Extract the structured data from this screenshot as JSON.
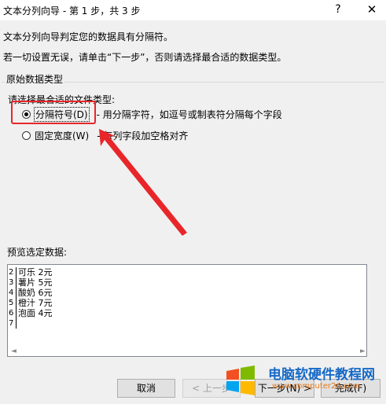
{
  "window": {
    "title": "文本分列向导 - 第 1 步，共 3 步",
    "help_label": "?",
    "close_label": "✕"
  },
  "intro": {
    "line1": "文本分列向导判定您的数据具有分隔符。",
    "line2": "若一切设置无误，请单击“下一步”，否则请选择最合适的数据类型。"
  },
  "group": {
    "title": "原始数据类型",
    "prompt": "请选择最合适的文件类型:",
    "options": [
      {
        "label": "分隔符号(D)",
        "description": "- 用分隔字符，如逗号或制表符分隔每个字段",
        "checked": true
      },
      {
        "label": "固定宽度(W)",
        "description": "- 每列字段加空格对齐",
        "checked": false
      }
    ]
  },
  "preview": {
    "label": "预览选定数据:",
    "rows": [
      {
        "num": "2",
        "text": "可乐 2元"
      },
      {
        "num": "3",
        "text": "薯片 5元"
      },
      {
        "num": "4",
        "text": "酸奶 6元"
      },
      {
        "num": "5",
        "text": "橙汁 7元"
      },
      {
        "num": "6",
        "text": "泡面 4元"
      },
      {
        "num": "7",
        "text": ""
      }
    ],
    "scroll_left": "◄",
    "scroll_right": "►"
  },
  "buttons": {
    "cancel": "取消",
    "back": "< 上一步",
    "next": "下一步(N) >",
    "finish": "完成(F)"
  },
  "watermark": {
    "title": "电脑软硬件教程网",
    "url": "www.computer26.com"
  },
  "colors": {
    "highlight": "#e8262a",
    "watermark_title": "#1569c7",
    "watermark_url": "#e07a1f"
  }
}
